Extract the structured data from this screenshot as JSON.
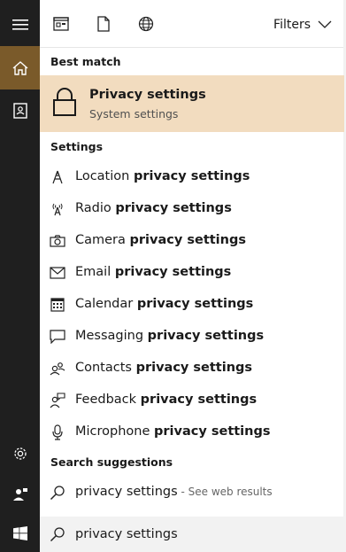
{
  "rail": {
    "icons": [
      "hamburger-icon",
      "home-icon",
      "notebook-icon",
      "gear-icon",
      "feedback-icon",
      "windows-icon"
    ],
    "accent": "#7a5a2a"
  },
  "toolbar": {
    "filters_label": "Filters"
  },
  "best_match": {
    "header": "Best match",
    "title": "Privacy settings",
    "subtitle": "System settings",
    "highlight": "#f2dcbf"
  },
  "settings": {
    "header": "Settings",
    "items": [
      {
        "prefix": "Location ",
        "bold": "privacy settings",
        "icon": "location-icon"
      },
      {
        "prefix": "Radio ",
        "bold": "privacy settings",
        "icon": "radio-icon"
      },
      {
        "prefix": "Camera ",
        "bold": "privacy settings",
        "icon": "camera-icon"
      },
      {
        "prefix": "Email ",
        "bold": "privacy settings",
        "icon": "email-icon"
      },
      {
        "prefix": "Calendar ",
        "bold": "privacy settings",
        "icon": "calendar-icon"
      },
      {
        "prefix": "Messaging ",
        "bold": "privacy settings",
        "icon": "message-icon"
      },
      {
        "prefix": "Contacts ",
        "bold": "privacy settings",
        "icon": "contacts-icon"
      },
      {
        "prefix": "Feedback ",
        "bold": "privacy settings",
        "icon": "feedback-icon"
      },
      {
        "prefix": "Microphone ",
        "bold": "privacy settings",
        "icon": "microphone-icon"
      }
    ]
  },
  "suggestions": {
    "header": "Search suggestions",
    "items": [
      {
        "query": "privacy settings",
        "hint": " - See web results"
      }
    ]
  },
  "search": {
    "value": "privacy settings"
  }
}
